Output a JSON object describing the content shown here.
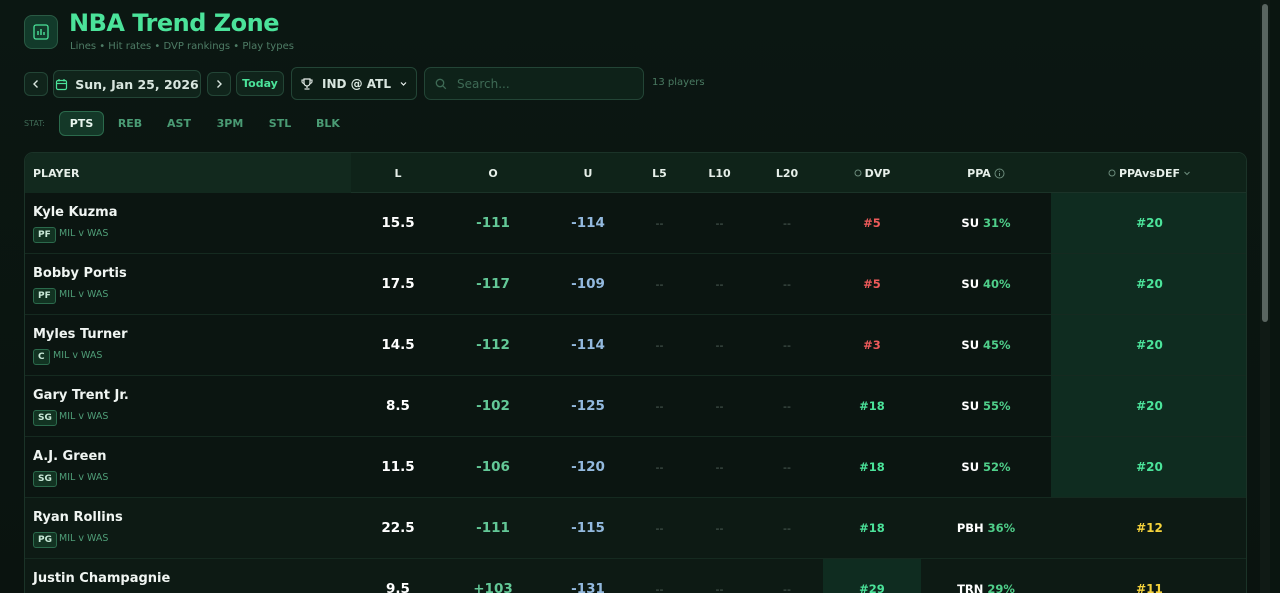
{
  "header": {
    "title": "NBA Trend Zone",
    "subtitle": "Lines • Hit rates • DVP rankings • Play types"
  },
  "toolbar": {
    "date": "Sun, Jan 25, 2026",
    "today_label": "Today",
    "game": "IND @ ATL",
    "search_placeholder": "Search...",
    "player_count": "13 players"
  },
  "stat_tabs": {
    "label": "STAT:",
    "tabs": [
      "PTS",
      "REB",
      "AST",
      "3PM",
      "STL",
      "BLK"
    ],
    "active": "PTS"
  },
  "table": {
    "columns": {
      "player": "PLAYER",
      "line": "L",
      "over": "O",
      "under": "U",
      "l5": "L5",
      "l10": "L10",
      "l20": "L20",
      "dvp": "DVP",
      "ppa": "PPA",
      "ppavsdef": "PPAvsDEF"
    },
    "rows": [
      {
        "name": "Kyle Kuzma",
        "pos": "PF",
        "team": "MIL",
        "opp": "v WAS",
        "line": "15.5",
        "over": "-111",
        "under": "-114",
        "l5": "--",
        "l10": "--",
        "l20": "--",
        "dvp": "#5",
        "dvp_tone": "red",
        "ppa_type": "SU",
        "ppa_pct": "31%",
        "ppavsdef": "#20",
        "def_tone": "green"
      },
      {
        "name": "Bobby Portis",
        "pos": "PF",
        "team": "MIL",
        "opp": "v WAS",
        "line": "17.5",
        "over": "-117",
        "under": "-109",
        "l5": "--",
        "l10": "--",
        "l20": "--",
        "dvp": "#5",
        "dvp_tone": "red",
        "ppa_type": "SU",
        "ppa_pct": "40%",
        "ppavsdef": "#20",
        "def_tone": "green"
      },
      {
        "name": "Myles Turner",
        "pos": "C",
        "team": "MIL",
        "opp": "v WAS",
        "line": "14.5",
        "over": "-112",
        "under": "-114",
        "l5": "--",
        "l10": "--",
        "l20": "--",
        "dvp": "#3",
        "dvp_tone": "red",
        "ppa_type": "SU",
        "ppa_pct": "45%",
        "ppavsdef": "#20",
        "def_tone": "green"
      },
      {
        "name": "Gary Trent Jr.",
        "pos": "SG",
        "team": "MIL",
        "opp": "v WAS",
        "line": "8.5",
        "over": "-102",
        "under": "-125",
        "l5": "--",
        "l10": "--",
        "l20": "--",
        "dvp": "#18",
        "dvp_tone": "green",
        "ppa_type": "SU",
        "ppa_pct": "55%",
        "ppavsdef": "#20",
        "def_tone": "green"
      },
      {
        "name": "A.J. Green",
        "pos": "SG",
        "team": "MIL",
        "opp": "v WAS",
        "line": "11.5",
        "over": "-106",
        "under": "-120",
        "l5": "--",
        "l10": "--",
        "l20": "--",
        "dvp": "#18",
        "dvp_tone": "green",
        "ppa_type": "SU",
        "ppa_pct": "52%",
        "ppavsdef": "#20",
        "def_tone": "green"
      },
      {
        "name": "Ryan Rollins",
        "pos": "PG",
        "team": "MIL",
        "opp": "v WAS",
        "line": "22.5",
        "over": "-111",
        "under": "-115",
        "l5": "--",
        "l10": "--",
        "l20": "--",
        "dvp": "#18",
        "dvp_tone": "green",
        "ppa_type": "PBH",
        "ppa_pct": "36%",
        "ppavsdef": "#12",
        "def_tone": "yellow"
      },
      {
        "name": "Justin Champagnie",
        "pos": "",
        "team": "",
        "opp": "",
        "line": "9.5",
        "over": "+103",
        "under": "-131",
        "l5": "--",
        "l10": "--",
        "l20": "--",
        "dvp": "#29",
        "dvp_tone": "green",
        "ppa_type": "TRN",
        "ppa_pct": "29%",
        "ppavsdef": "#11",
        "def_tone": "yellow"
      }
    ]
  },
  "colors": {
    "accent": "#4be39a",
    "background": "#0a1510",
    "dvp_bad": "#ef5b5b",
    "def_mid": "#f5d33c"
  }
}
